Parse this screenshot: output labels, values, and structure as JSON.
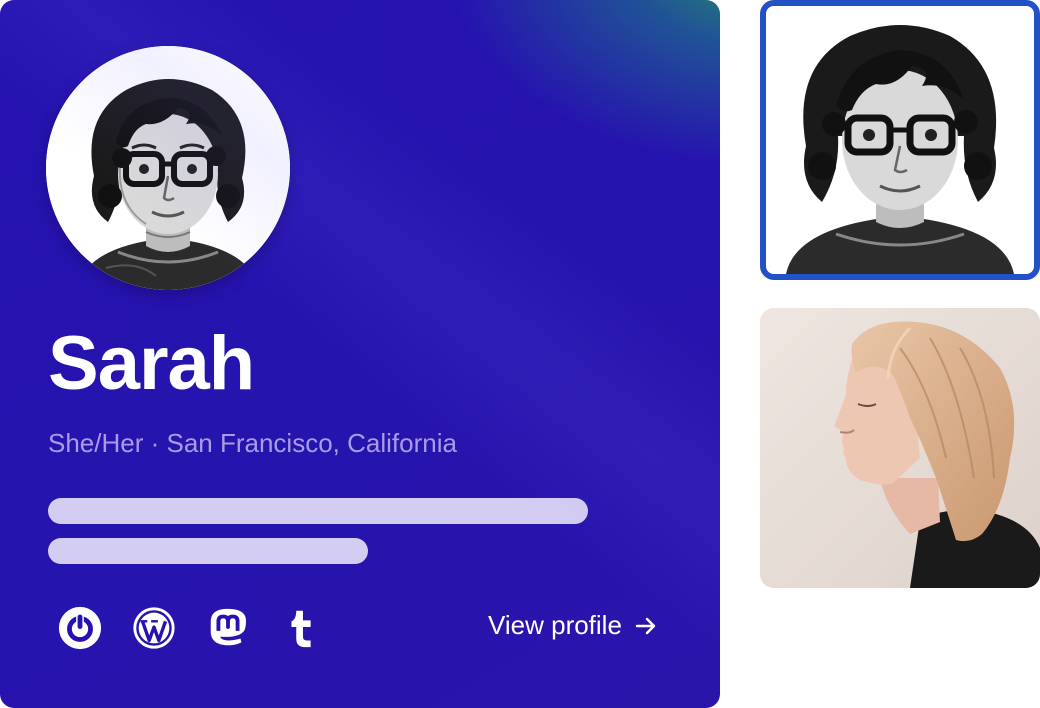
{
  "profile": {
    "name": "Sarah",
    "subtitle": "She/Her · San Francisco, California",
    "view_profile_label": "View profile",
    "avatar_icon": "illustrated-portrait-avatar"
  },
  "socials": [
    {
      "name": "power-logo-icon"
    },
    {
      "name": "wordpress-icon"
    },
    {
      "name": "mastodon-icon"
    },
    {
      "name": "tumblr-icon"
    }
  ],
  "thumbnails": [
    {
      "name": "illustrated-portrait",
      "selected": true
    },
    {
      "name": "photo-portrait",
      "selected": false
    }
  ],
  "colors": {
    "card_background": "#2512b0",
    "card_accent_gradient": "#24966a",
    "subtitle_text": "#a89ce6",
    "placeholder_bar": "#d4cdf2",
    "selection_border": "#2450c8",
    "text_primary": "#ffffff"
  }
}
